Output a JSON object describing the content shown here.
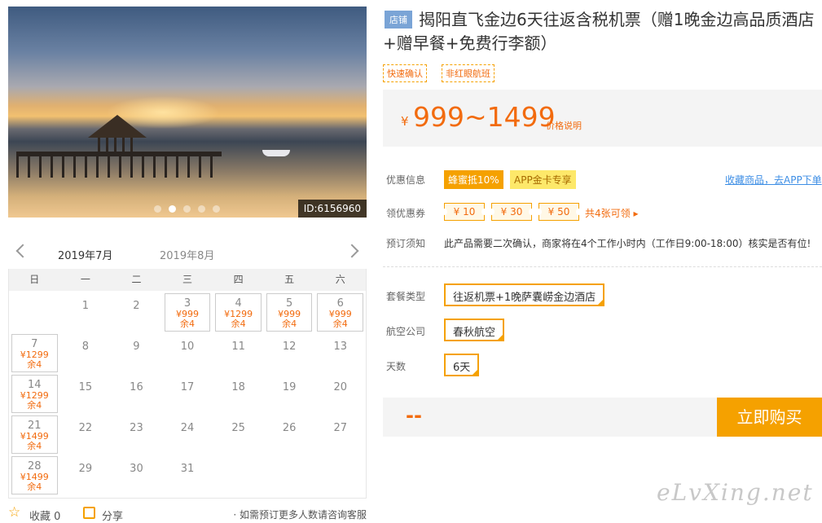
{
  "photo": {
    "id_label": "ID:6156960",
    "dots": 5,
    "active_dot": 1
  },
  "calendar": {
    "months": [
      "2019年7月",
      "2019年8月"
    ],
    "weekdays": [
      "日",
      "一",
      "二",
      "三",
      "四",
      "五",
      "六"
    ],
    "rows": [
      [
        null,
        {
          "d": "1"
        },
        {
          "d": "2"
        },
        {
          "d": "3",
          "p": "¥999",
          "r": "余4"
        },
        {
          "d": "4",
          "p": "¥1299",
          "r": "余4"
        },
        {
          "d": "5",
          "p": "¥999",
          "r": "余4"
        },
        {
          "d": "6",
          "p": "¥999",
          "r": "余4"
        }
      ],
      [
        {
          "d": "7",
          "p": "¥1299",
          "r": "余4"
        },
        {
          "d": "8"
        },
        {
          "d": "9"
        },
        {
          "d": "10"
        },
        {
          "d": "11"
        },
        {
          "d": "12"
        },
        {
          "d": "13"
        }
      ],
      [
        {
          "d": "14",
          "p": "¥1299",
          "r": "余4"
        },
        {
          "d": "15"
        },
        {
          "d": "16"
        },
        {
          "d": "17"
        },
        {
          "d": "18"
        },
        {
          "d": "19"
        },
        {
          "d": "20"
        }
      ],
      [
        {
          "d": "21",
          "p": "¥1499",
          "r": "余4"
        },
        {
          "d": "22"
        },
        {
          "d": "23"
        },
        {
          "d": "24"
        },
        {
          "d": "25"
        },
        {
          "d": "26"
        },
        {
          "d": "27"
        }
      ],
      [
        {
          "d": "28",
          "p": "¥1499",
          "r": "余4"
        },
        {
          "d": "29"
        },
        {
          "d": "30"
        },
        {
          "d": "31"
        },
        null,
        null,
        null
      ]
    ]
  },
  "footer": {
    "favorite": "收藏 0",
    "share": "分享",
    "hint": "· 如需预订更多人数请咨询客服"
  },
  "product": {
    "shop_tag": "店铺",
    "title": "揭阳直飞金边6天往返含税机票（赠1晚金边高品质酒店+赠早餐+免费行李额）",
    "tags": [
      "快速确认",
      "非红眼航班"
    ],
    "price_currency": "¥",
    "price": "999~1499",
    "price_note": "价格说明"
  },
  "promo": {
    "label": "优惠信息",
    "badge1": "蜂蜜抵10%",
    "badge2": "APP金卡专享",
    "link": "收藏商品，去APP下单"
  },
  "coupons": {
    "label": "领优惠券",
    "items": [
      "¥ 10",
      "¥ 30",
      "¥ 50"
    ],
    "note": "共4张可领 ▸"
  },
  "notice": {
    "label": "预订须知",
    "text": "此产品需要二次确认，商家将在4个工作小时内（工作日9:00-18:00）核实是否有位!"
  },
  "options": {
    "package_label": "套餐类型",
    "package": "往返机票+1晚萨囊崂金边酒店",
    "airline_label": "航空公司",
    "airline": "春秋航空",
    "days_label": "天数",
    "days": "6天"
  },
  "buy": {
    "total": "--",
    "button": "立即购买"
  },
  "watermark": "eLvXing.net"
}
